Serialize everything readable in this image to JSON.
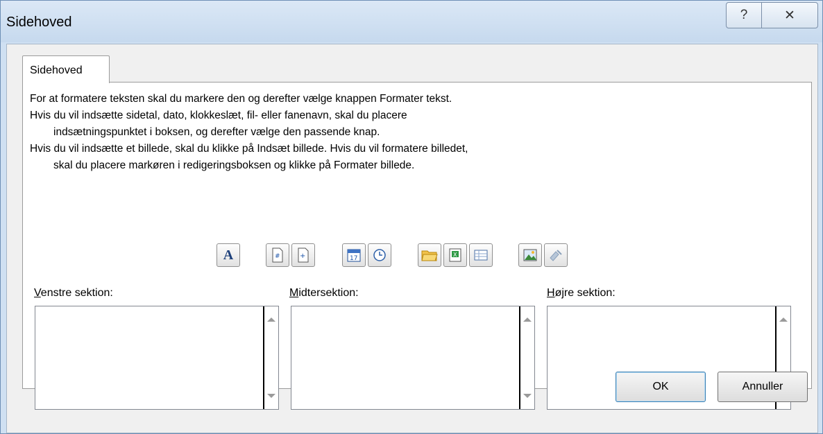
{
  "window": {
    "title": "Sidehoved",
    "help_glyph": "?",
    "close_glyph": "✕"
  },
  "tab": {
    "label": "Sidehoved"
  },
  "instructions": {
    "line1": "For at formatere teksten skal du markere den og derefter vælge knappen Formater tekst.",
    "line2": "Hvis du vil indsætte sidetal, dato, klokkeslæt, fil- eller fanenavn, skal du placere",
    "line3": "indsætningspunktet i boksen, og derefter vælge den passende knap.",
    "line4": "Hvis du vil indsætte et billede, skal du klikke på Indsæt billede. Hvis du vil formatere billedet,",
    "line5": "skal du placere markøren i redigeringsboksen og klikke på Formater billede."
  },
  "toolbar": {
    "format_text_glyph": "A",
    "icons": [
      "format-text-icon",
      "insert-page-number-icon",
      "insert-page-count-icon",
      "insert-date-icon",
      "insert-time-icon",
      "insert-file-path-icon",
      "insert-file-name-icon",
      "insert-sheet-name-icon",
      "insert-picture-icon",
      "format-picture-icon"
    ]
  },
  "sections": {
    "left_label_key": "V",
    "left_label_rest": "enstre sektion:",
    "center_label_key": "M",
    "center_label_rest": "idtersektion:",
    "right_label_key": "H",
    "right_label_rest": "øjre sektion:"
  },
  "buttons": {
    "ok": "OK",
    "cancel": "Annuller"
  },
  "colors": {
    "window_frame": "#cfe0f2",
    "client": "#f0f0f0",
    "accent_border": "#3c7fb1"
  }
}
